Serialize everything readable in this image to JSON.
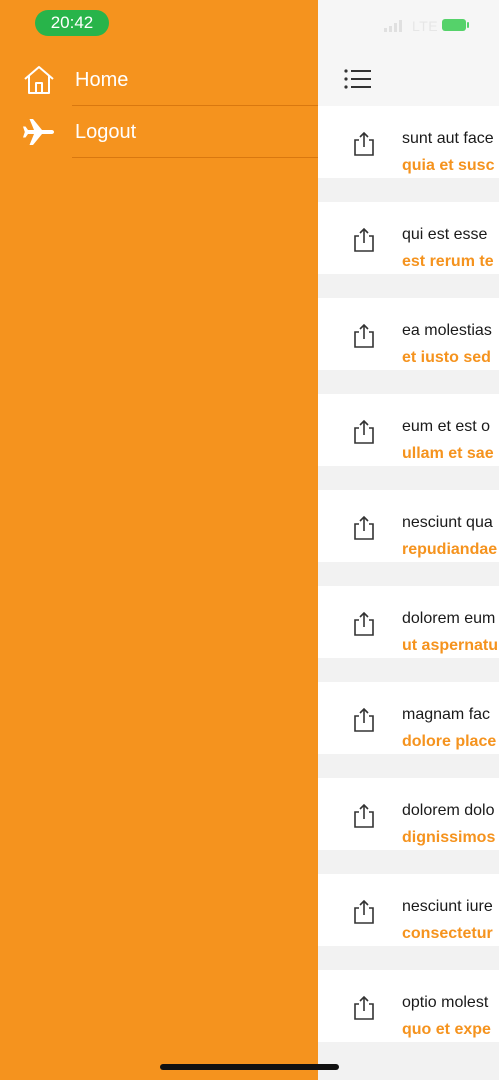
{
  "status": {
    "time": "20:42",
    "network": "LTE"
  },
  "drawer": {
    "items": [
      {
        "label": "Home",
        "icon": "home-icon"
      },
      {
        "label": "Logout",
        "icon": "airplane-icon"
      }
    ]
  },
  "header": {
    "menu_icon": "list-menu-icon"
  },
  "posts": [
    {
      "title": "sunt aut face",
      "subtitle": "quia et susc"
    },
    {
      "title": "qui est esse",
      "subtitle": "est rerum te"
    },
    {
      "title": "ea molestias",
      "subtitle": "et iusto sed"
    },
    {
      "title": "eum et est o",
      "subtitle": "ullam et sae"
    },
    {
      "title": "nesciunt qua",
      "subtitle": "repudiandae"
    },
    {
      "title": "dolorem eum",
      "subtitle": "ut aspernatu"
    },
    {
      "title": "magnam fac",
      "subtitle": "dolore place"
    },
    {
      "title": "dolorem dolo",
      "subtitle": "dignissimos"
    },
    {
      "title": "nesciunt iure",
      "subtitle": "consectetur"
    },
    {
      "title": "optio molest",
      "subtitle": "quo et expe"
    }
  ],
  "colors": {
    "accent": "#f5931e",
    "time_pill": "#28b44a"
  }
}
